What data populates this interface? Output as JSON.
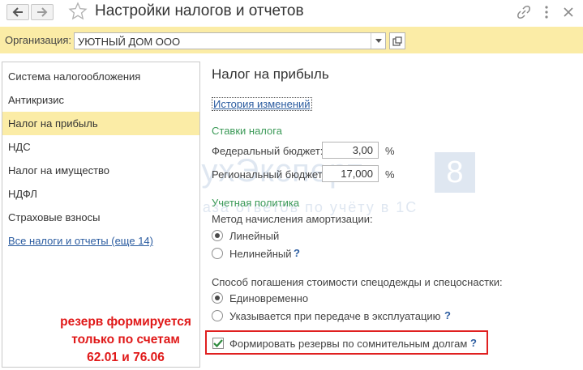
{
  "window": {
    "title": "Настройки налогов и отчетов",
    "back_icon": "arrow-left-icon",
    "forward_icon": "arrow-right-icon",
    "favorite_icon": "star-icon"
  },
  "org": {
    "label": "Организация:",
    "value": "УЮТНЫЙ ДОМ ООО"
  },
  "sidebar": {
    "items": [
      {
        "label": "Система налогообложения"
      },
      {
        "label": "Антикризис"
      },
      {
        "label": "Налог на прибыль",
        "active": true
      },
      {
        "label": "НДС"
      },
      {
        "label": "Налог на имущество"
      },
      {
        "label": "НДФЛ"
      },
      {
        "label": "Страховые взносы"
      }
    ],
    "all_taxes_link": "Все налоги и отчеты (еще 14)"
  },
  "main": {
    "title": "Налог на прибыль",
    "history_link": "История изменений",
    "rates": {
      "section": "Ставки налога",
      "federal_label": "Федеральный бюджет:",
      "federal_value": "3,00",
      "regional_label": "Региональный бюджет:",
      "regional_value": "17,000",
      "unit": "%"
    },
    "policy": {
      "section": "Учетная политика",
      "depreciation_label": "Метод начисления амортизации:",
      "depreciation_options": [
        {
          "label": "Линейный",
          "selected": true
        },
        {
          "label": "Нелинейный",
          "selected": false
        }
      ],
      "workwear_label": "Способ погашения стоимости спецодежды и спецоснастки:",
      "workwear_options": [
        {
          "label": "Единовременно",
          "selected": true
        },
        {
          "label": "Указывается при передаче в эксплуатацию",
          "selected": false
        }
      ],
      "reserves_label": "Формировать резервы по сомнительным долгам",
      "reserves_checked": true,
      "help": "?"
    }
  },
  "annotation": {
    "line1": "резерв формируется",
    "line2": "только по счетам",
    "line3": "62.01 и 76.06"
  },
  "watermark": {
    "brand": "БухЭксперт",
    "badge": "8",
    "tagline": "База ответов по учёту в 1С"
  },
  "colors": {
    "accent_yellow": "#fbeca6",
    "section_green": "#3c9a58",
    "link_blue": "#2b5ca0",
    "annotation_red": "#e02020"
  }
}
